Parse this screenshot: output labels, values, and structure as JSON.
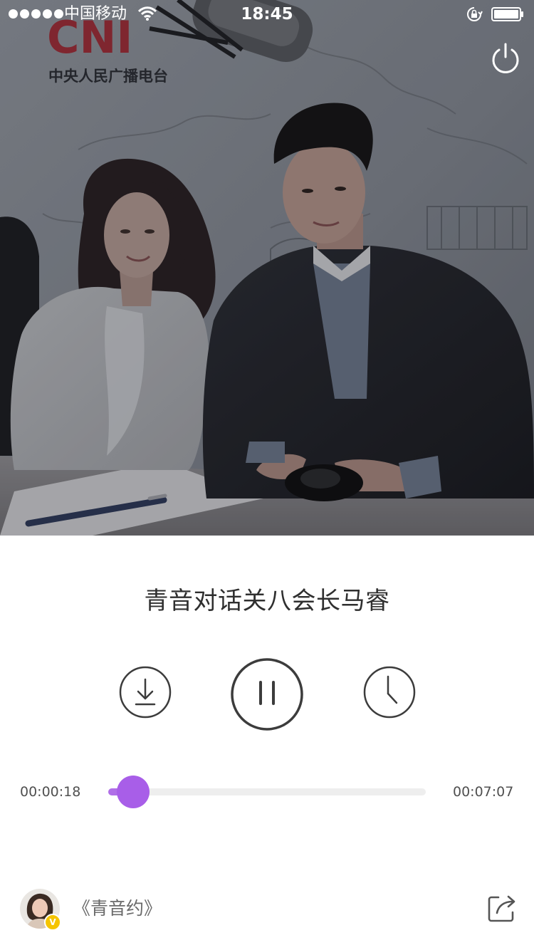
{
  "status_bar": {
    "carrier": "中国移动",
    "time": "18:45",
    "icons": [
      "signal-dots",
      "wifi-icon",
      "rotation-lock-icon",
      "battery-icon"
    ]
  },
  "hero": {
    "photo": "studio-photo-two-hosts",
    "logo_text": "CNI",
    "station_text": "中央人民广播电台"
  },
  "header": {
    "power_icon": "power-icon"
  },
  "player": {
    "title": "青音对话关八会长马睿",
    "controls": {
      "download_icon": "download-icon",
      "pause_icon": "pause-icon",
      "timer_icon": "clock-icon"
    },
    "progress": {
      "current_time": "00:00:18",
      "total_time": "00:07:07",
      "fraction": 0.042
    },
    "accent_color": "#a85ee8"
  },
  "footer": {
    "program_name": "《青音约》",
    "badge": "V",
    "share_icon": "share-icon"
  }
}
